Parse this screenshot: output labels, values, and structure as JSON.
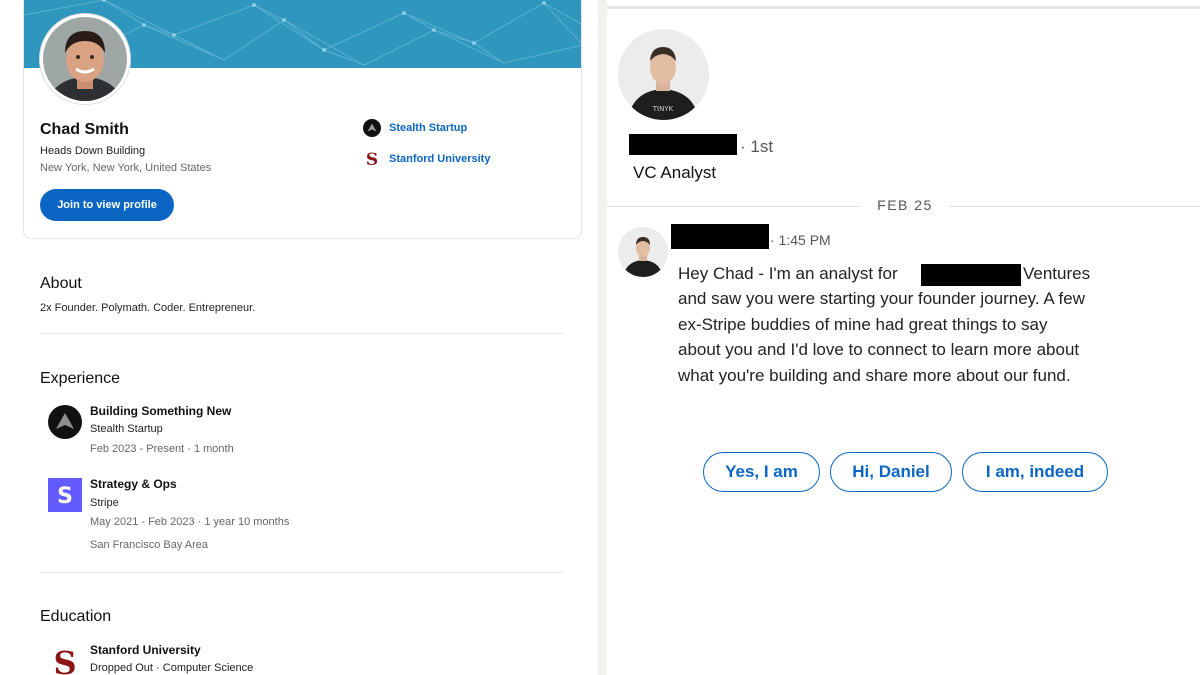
{
  "profile": {
    "name": "Chad Smith",
    "headline": "Heads Down Building",
    "location": "New York, New York, United States",
    "join_button": "Join to view profile",
    "current_company": "Stealth Startup",
    "school": "Stanford University"
  },
  "about": {
    "title": "About",
    "text": "2x Founder. Polymath. Coder. Entrepreneur."
  },
  "experience": {
    "title": "Experience",
    "items": [
      {
        "title": "Building Something New",
        "company": "Stealth Startup",
        "dates": "Feb 2023 - Present · 1 month",
        "location": "",
        "logo": "stealth-logo"
      },
      {
        "title": "Strategy & Ops",
        "company": "Stripe",
        "dates": "May 2021 - Feb 2023 · 1 year 10 months",
        "location": "San Francisco Bay Area",
        "logo": "stripe-logo"
      }
    ]
  },
  "education": {
    "title": "Education",
    "school": "Stanford University",
    "details": "Dropped Out · Computer Science"
  },
  "conversation": {
    "degree": "· 1st",
    "sender_title": "VC Analyst",
    "date_divider": "FEB 25",
    "time": "· 1:45 PM",
    "message_lines": [
      "Hey Chad - I'm an analyst for",
      "Ventures",
      "and saw you were starting your founder journey. A few",
      "ex-Stripe buddies of mine had great things to say",
      "about you and I'd love to connect to learn more about",
      "what you're building and share more about our fund."
    ],
    "quick_replies": [
      "Yes, I am",
      "Hi, Daniel",
      "I am, indeed"
    ]
  },
  "colors": {
    "accent": "#0a66c2",
    "cover": "#2f96bd",
    "stripe": "#635bff",
    "stanford": "#8c1515",
    "redaction": "#000000"
  }
}
